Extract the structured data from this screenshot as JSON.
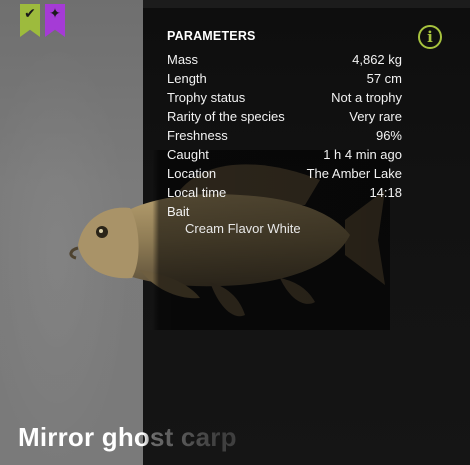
{
  "badges": [
    {
      "name": "check",
      "glyph": "✔",
      "color": "#9dbb3d"
    },
    {
      "name": "sparkle",
      "glyph": "✦",
      "color": "#a53bd6"
    }
  ],
  "info_icon": {
    "glyph": "i",
    "color": "#a7c33e"
  },
  "parameters": {
    "heading": "PARAMETERS",
    "rows": [
      {
        "label": "Mass",
        "value": "4,862 kg"
      },
      {
        "label": "Length",
        "value": "57 cm"
      },
      {
        "label": "Trophy status",
        "value": "Not a trophy"
      },
      {
        "label": "Rarity of the species",
        "value": "Very rare"
      },
      {
        "label": "Freshness",
        "value": "96%"
      },
      {
        "label": "Caught",
        "value": "1 h 4 min ago"
      },
      {
        "label": "Location",
        "value": "The Amber Lake"
      },
      {
        "label": "Local time",
        "value": "14:18"
      }
    ],
    "bait_label": "Bait",
    "bait_value": "Cream Flavor White"
  },
  "fish_name": "Mirror ghost carp"
}
